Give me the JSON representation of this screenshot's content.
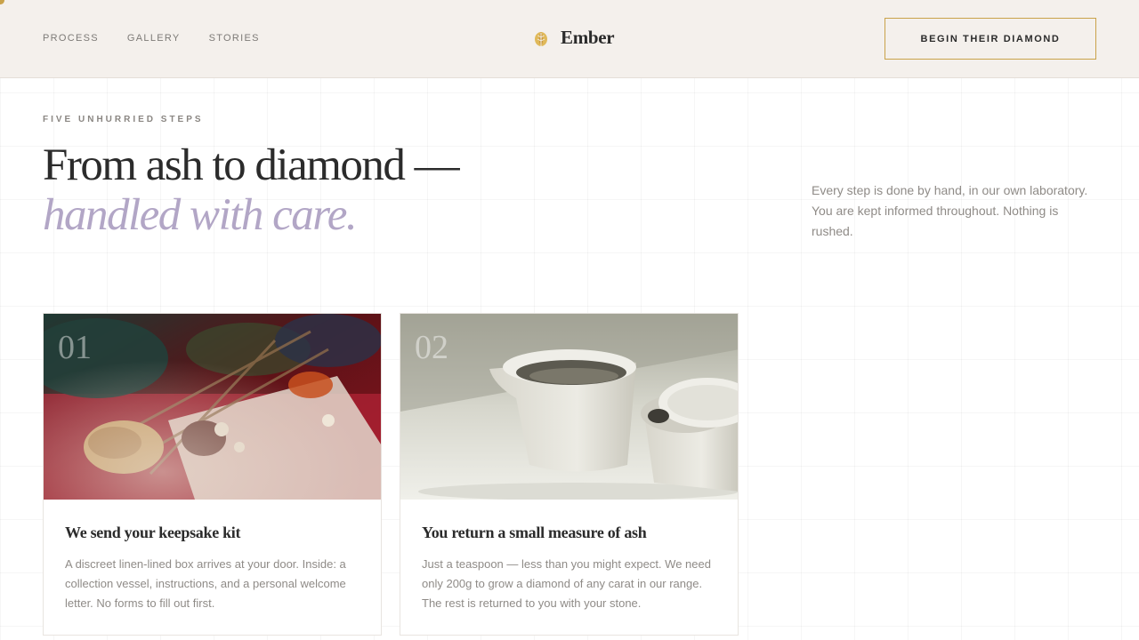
{
  "nav": {
    "items": [
      {
        "label": "PROCESS"
      },
      {
        "label": "GALLERY"
      },
      {
        "label": "STORIES"
      }
    ]
  },
  "brand": {
    "name": "Ember",
    "icon": "ember-leaf-icon"
  },
  "cta": {
    "label": "BEGIN THEIR DIAMOND"
  },
  "hero": {
    "eyebrow": "FIVE UNHURRIED STEPS",
    "headline_line1": "From ash to diamond —",
    "headline_line2": "handled with care.",
    "intro": "Every step is done by hand, in our own laboratory. You are kept informed throughout. Nothing is rushed."
  },
  "steps": [
    {
      "number": "01",
      "title": "We send your keepsake kit",
      "body": "A discreet linen-lined box arrives at your door. Inside: a collection vessel, instructions, and a personal welcome letter. No forms to fill out first."
    },
    {
      "number": "02",
      "title": "You return a small measure of ash",
      "body": "Just a teaspoon — less than you might expect. We need only 200g to grow a diamond of any carat in our range. The rest is returned to you with your stone."
    }
  ],
  "colors": {
    "header_bg": "#f4f0ec",
    "accent_gold": "#c9a24a",
    "accent_lavender": "#b2a6c6",
    "text_dark": "#2b2b2b",
    "text_muted": "#8f8b87"
  }
}
